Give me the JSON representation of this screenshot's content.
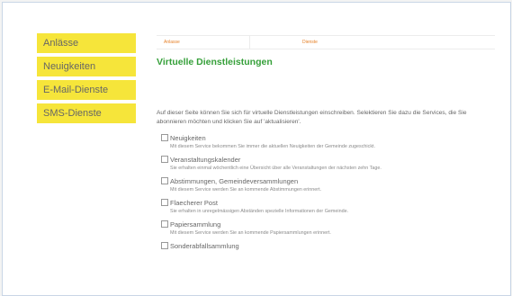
{
  "sidebar": {
    "items": [
      {
        "label": "Anlässe"
      },
      {
        "label": "Neuigkeiten"
      },
      {
        "label": "E-Mail-Dienste"
      },
      {
        "label": "SMS-Dienste"
      }
    ]
  },
  "main": {
    "tabs": [
      {
        "label": "Anlasse"
      },
      {
        "label": "Dienste"
      }
    ],
    "title": "Virtuelle Dienstleistungen",
    "intro": "Auf dieser Seite können Sie sich für virtuelle Dienstleistungen einschreiben. Selektieren Sie dazu die Services, die Sie abonnieren möchten und klicken Sie auf 'aktualisieren'.",
    "services": [
      {
        "name": "Neuigkeiten",
        "description": "Mit diesem Service bekommen Sie immer die aktuellen Neuigkeiten der Gemeinde zugeschickt."
      },
      {
        "name": "Veranstaltungskalender",
        "description": "Sie erhalten einmal wöchentlich eine Übersicht über alle Veranstaltungen der nächsten zehn Tage."
      },
      {
        "name": "Abstimmungen, Gemeindeversammlungen",
        "description": "Mit diesem Service werden Sie an kommende Abstimmungen erinnert."
      },
      {
        "name": "Flaecherer Post",
        "description": "Sie erhalten in unregelmässigen Abständen spezielle Informationen der Gemeinde."
      },
      {
        "name": "Papiersammlung",
        "description": "Mit diesem Service werden Sie an kommende Papiersammlungen erinnert."
      },
      {
        "name": "Sonderabfallsammlung",
        "description": ""
      }
    ]
  }
}
